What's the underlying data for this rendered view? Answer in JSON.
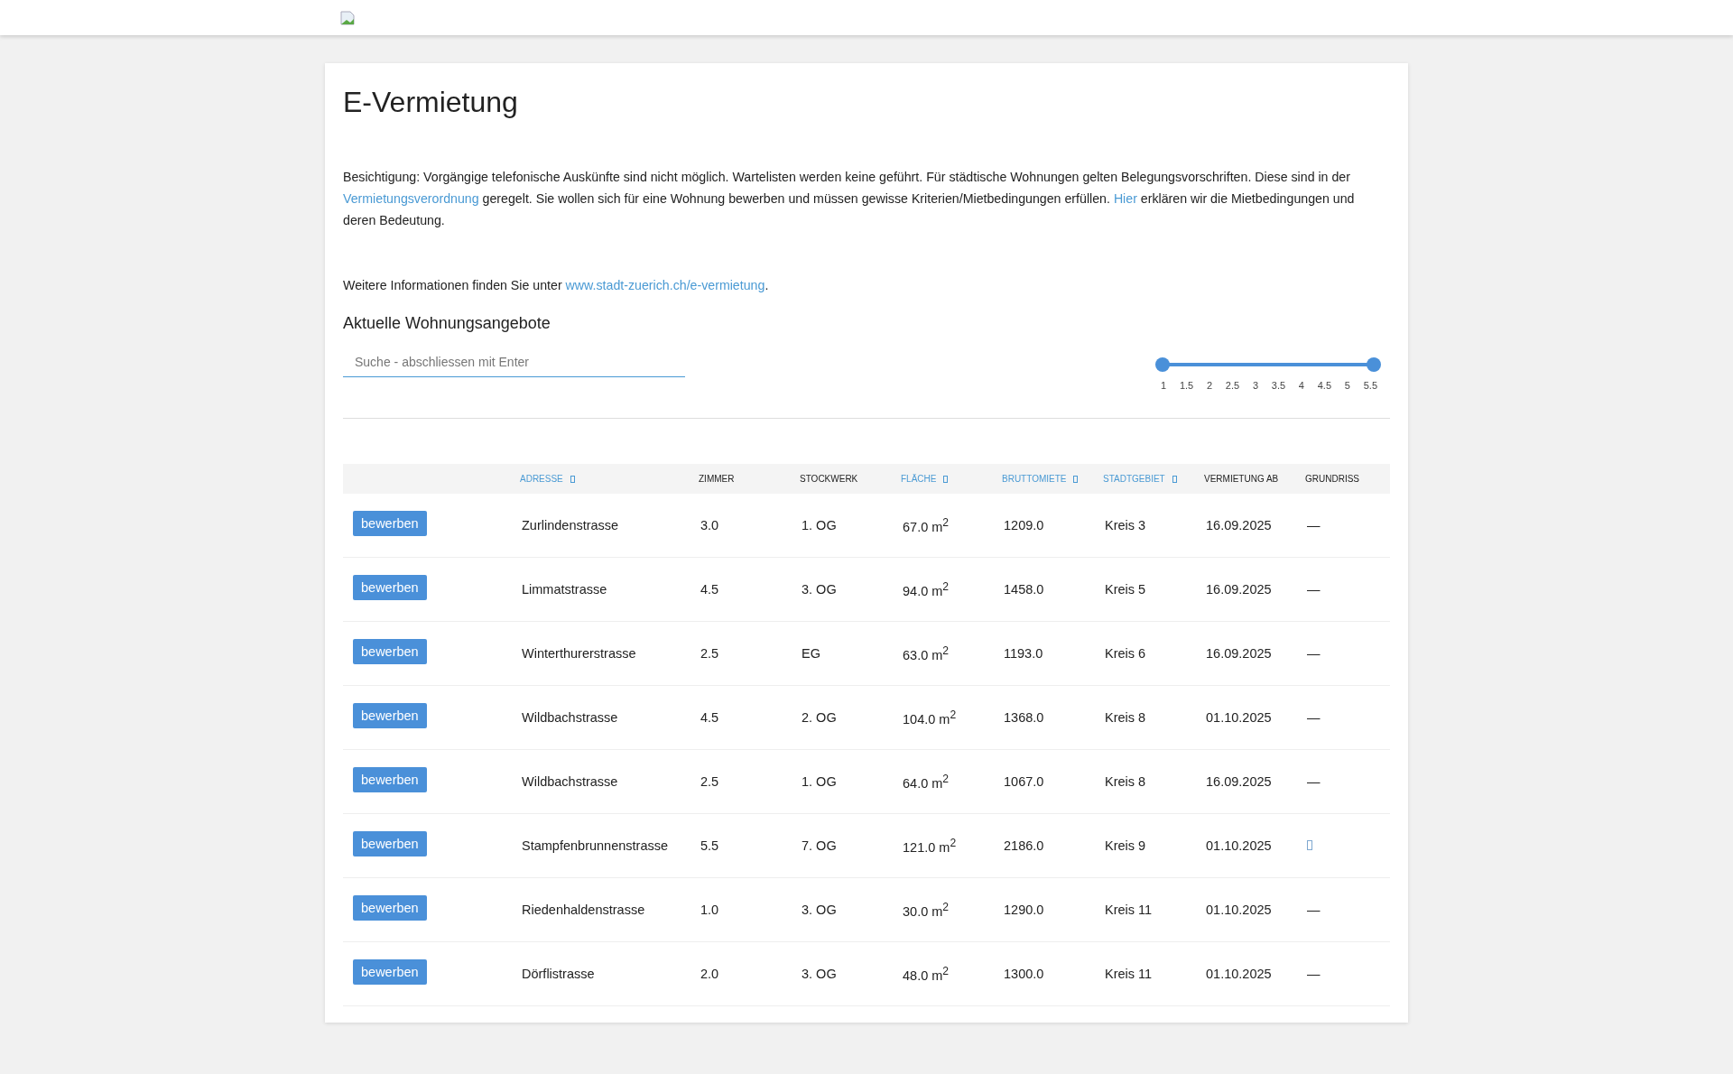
{
  "title": "E-Vermietung",
  "intro": [
    {
      "kind": "text",
      "text": "Besichtigung: Vorgängige telefonische Auskünfte sind nicht möglich. Wartelisten werden keine geführt. Für städtische Wohnungen gelten Belegungsvorschriften. Diese sind in der "
    },
    {
      "kind": "link",
      "text": "Vermietungsverordnung"
    },
    {
      "kind": "text",
      "text": " geregelt. Sie wollen sich für eine Wohnung bewerben und müssen gewisse Kriterien/Mietbedingungen erfüllen. "
    },
    {
      "kind": "link",
      "text": "Hier"
    },
    {
      "kind": "text",
      "text": " erklären wir die Mietbedingungen und deren Bedeutung."
    }
  ],
  "more_info": [
    {
      "kind": "text",
      "text": "Weitere Informationen finden Sie unter "
    },
    {
      "kind": "link",
      "text": "www.stadt-zuerich.ch/e-vermietung"
    },
    {
      "kind": "text",
      "text": "."
    }
  ],
  "section_title": "Aktuelle Wohnungsangebote",
  "search": {
    "placeholder": "Suche - abschliessen mit Enter"
  },
  "room_slider": {
    "thumbs": [
      {
        "level": 0
      },
      {
        "level": 1
      }
    ],
    "ticks": [
      "1",
      "1.5",
      "2",
      "2.5",
      "3",
      "3.5",
      "4",
      "4.5",
      "5",
      "5.5"
    ]
  },
  "table": {
    "columns": [
      {
        "label": "ADRESSE",
        "sortable": true
      },
      {
        "label": "ZIMMER",
        "sortable": false
      },
      {
        "label": "STOCKWERK",
        "sortable": false
      },
      {
        "label": "FLÄCHE",
        "sortable": true
      },
      {
        "label": "BRUTTOMIETE",
        "sortable": true
      },
      {
        "label": "STADTGEBIET",
        "sortable": true
      },
      {
        "label": "VERMIETUNG AB",
        "sortable": false
      },
      {
        "label": "GRUNDRISS",
        "sortable": false
      }
    ],
    "rows": [
      {
        "button": "bewerben",
        "address": "Zurlindenstrasse",
        "rooms": "3.0",
        "floor": "1. OG",
        "area": "67.0 m$^{2}$",
        "rent": "1209.0",
        "district": "Kreis 3",
        "available": "16.09.2025",
        "floorplan": {
          "kind": "text",
          "text": "—"
        }
      },
      {
        "button": "bewerben",
        "address": "Limmatstrasse",
        "rooms": "4.5",
        "floor": "3. OG",
        "area": "94.0 m$^{2}$",
        "rent": "1458.0",
        "district": "Kreis 5",
        "available": "16.09.2025",
        "floorplan": {
          "kind": "text",
          "text": "—"
        }
      },
      {
        "button": "bewerben",
        "address": "Winterthurerstrasse",
        "rooms": "2.5",
        "floor": "EG",
        "area": "63.0 m$^{2}$",
        "rent": "1193.0",
        "district": "Kreis 6",
        "available": "16.09.2025",
        "floorplan": {
          "kind": "text",
          "text": "—"
        }
      },
      {
        "button": "bewerben",
        "address": "Wildbachstrasse",
        "rooms": "4.5",
        "floor": "2. OG",
        "area": "104.0 m$^{2}$",
        "rent": "1368.0",
        "district": "Kreis 8",
        "available": "01.10.2025",
        "floorplan": {
          "kind": "text",
          "text": "—"
        }
      },
      {
        "button": "bewerben",
        "address": "Wildbachstrasse",
        "rooms": "2.5",
        "floor": "1. OG",
        "area": "64.0 m$^{2}$",
        "rent": "1067.0",
        "district": "Kreis 8",
        "available": "16.09.2025",
        "floorplan": {
          "kind": "text",
          "text": "—"
        }
      },
      {
        "button": "bewerben",
        "address": "Stampfenbrunnenstrasse",
        "rooms": "5.5",
        "floor": "7. OG",
        "area": "121.0 m$^{2}$",
        "rent": "2186.0",
        "district": "Kreis 9",
        "available": "01.10.2025",
        "floorplan": {
          "kind": "icon"
        }
      },
      {
        "button": "bewerben",
        "address": "Riedenhaldenstrasse",
        "rooms": "1.0",
        "floor": "3. OG",
        "area": "30.0 m$^{2}$",
        "rent": "1290.0",
        "district": "Kreis 11",
        "available": "01.10.2025",
        "floorplan": {
          "kind": "text",
          "text": "—"
        }
      },
      {
        "button": "bewerben",
        "address": "Dörflistrasse",
        "rooms": "2.0",
        "floor": "3. OG",
        "area": "48.0 m$^{2}$",
        "rent": "1300.0",
        "district": "Kreis 11",
        "available": "01.10.2025",
        "floorplan": {
          "kind": "text",
          "text": "—"
        }
      }
    ]
  }
}
